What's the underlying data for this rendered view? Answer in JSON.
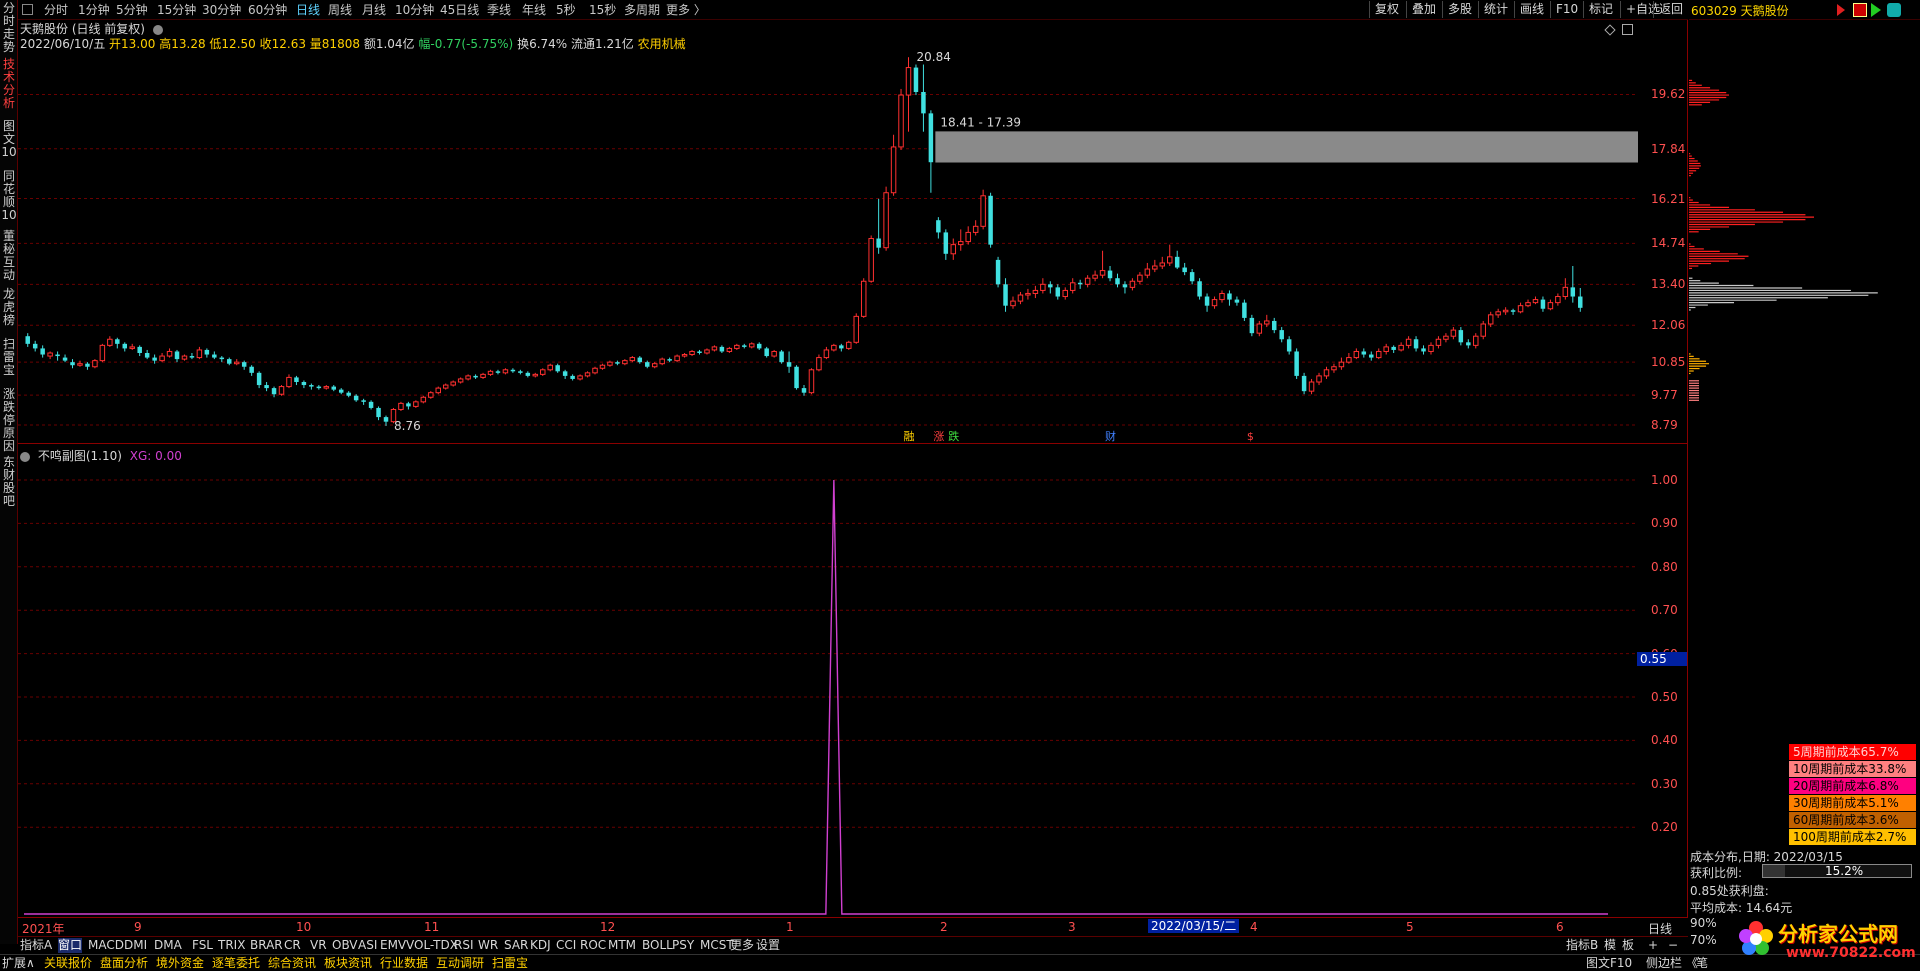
{
  "timeframes": [
    "分时",
    "1分钟",
    "5分钟",
    "15分钟",
    "30分钟",
    "60分钟",
    "日线",
    "周线",
    "月线",
    "10分钟",
    "45日线",
    "季线",
    "年线",
    "5秒",
    "15秒",
    "多周期",
    "更多 〉"
  ],
  "active_timeframe": "日线",
  "toolbar_right": [
    "复权",
    "叠加",
    "多股",
    "统计",
    "画线",
    "F10",
    "标记",
    "+自选",
    "返回"
  ],
  "stock_header": "603029 天鹅股份",
  "left_tabs": [
    "分时走势",
    "技术分析",
    "图文10",
    "同花顺10",
    "董秘互动",
    "龙虎榜",
    "扫雷宝",
    "涨跌停原因",
    "东财股吧"
  ],
  "active_left_tab": "技术分析",
  "title": "天鹅股份 (日线 前复权)",
  "info": {
    "date": "2022/06/10/五",
    "open": "开13.00",
    "high": "高13.28",
    "low": "低12.50",
    "close": "收12.63",
    "vol": "量81808",
    "amt": "额1.04亿",
    "chg": "幅-0.77(-5.75%)",
    "turnover": "换6.74%",
    "float": "流通1.21亿",
    "industry": "农用机械"
  },
  "annotations": {
    "high_label": "20.84",
    "low_label": "8.76",
    "gap_label": "18.41 - 17.39"
  },
  "markers": [
    "融",
    "涨",
    "跌",
    "财",
    "$"
  ],
  "price_axis": [
    "19.62",
    "17.84",
    "16.21",
    "14.74",
    "13.40",
    "12.06",
    "10.85",
    "9.77",
    "8.79"
  ],
  "sub_title": "不鸣副图(1.10)",
  "sub_xg": "XG: 0.00",
  "sub_axis": [
    "1.00",
    "0.90",
    "0.80",
    "0.70",
    "0.60",
    "0.50",
    "0.40",
    "0.30",
    "0.20"
  ],
  "sub_cursor": "0.55",
  "x_labels": [
    "2021年",
    "9",
    "10",
    "11",
    "12",
    "1",
    "2",
    "3",
    "4",
    "5",
    "6"
  ],
  "date_cursor": "2022/03/15/二",
  "x_axis_right": "日线",
  "indicator_tabs": [
    "指标A",
    "窗口",
    "MACD",
    "DMI",
    "DMA",
    "FSL",
    "TRIX",
    "BRAR",
    "CR",
    "VR",
    "OBV",
    "ASI",
    "EMV",
    "VOL-TDX",
    "RSI",
    "WR",
    "SAR",
    "KDJ",
    "CCI",
    "ROC",
    "MTM",
    "BOLL",
    "PSY",
    "MCST",
    "更多",
    "设置"
  ],
  "indicator_right": [
    "指标B",
    "模",
    "板",
    "+",
    "−"
  ],
  "bottom_tabs": [
    "扩展∧",
    "关联报价",
    "盘面分析",
    "境外资金",
    "逐笔委托",
    "综合资讯",
    "板块资讯",
    "行业数据",
    "互动调研",
    "扫雷宝"
  ],
  "bottom_right": [
    "图文F10",
    "侧边栏 《",
    "笔"
  ],
  "cost": {
    "rows": [
      {
        "label": "5周期前成本65.7%",
        "color": "#ff0000"
      },
      {
        "label": "10周期前成本33.8%",
        "color": "#ff8080"
      },
      {
        "label": "20周期前成本6.8%",
        "color": "#ff0080"
      },
      {
        "label": "30周期前成本5.1%",
        "color": "#ff8000"
      },
      {
        "label": "60周期前成本3.6%",
        "color": "#c06000"
      },
      {
        "label": "100周期前成本2.7%",
        "color": "#ffc000"
      }
    ],
    "date_line": "成本分布,日期: 2022/03/15",
    "profit_label": "获利比例:",
    "profit_value": "15.2%",
    "profit_at": "0.85处获利盘:",
    "avg_cost": "平均成本: 14.64元",
    "pct90": "90%",
    "pct70": "70%"
  },
  "watermark": {
    "text": "分析家公式网",
    "url": "www.70822.com"
  },
  "chart_data": {
    "type": "candlestick",
    "ylim": [
      8.3,
      21.6
    ],
    "candles": [
      [
        11.7,
        11.45,
        11.8,
        11.35
      ],
      [
        11.45,
        11.3,
        11.55,
        11.2
      ],
      [
        11.3,
        11.1,
        11.4,
        11.0
      ],
      [
        11.05,
        11.15,
        11.2,
        10.95
      ],
      [
        11.1,
        11.05,
        11.2,
        10.9
      ],
      [
        11.0,
        10.9,
        11.1,
        10.85
      ],
      [
        10.85,
        10.75,
        10.95,
        10.65
      ],
      [
        10.75,
        10.8,
        10.9,
        10.7
      ],
      [
        10.8,
        10.7,
        10.85,
        10.6
      ],
      [
        10.7,
        10.9,
        10.95,
        10.65
      ],
      [
        10.9,
        11.4,
        11.45,
        10.85
      ],
      [
        11.4,
        11.6,
        11.7,
        11.35
      ],
      [
        11.6,
        11.45,
        11.65,
        11.3
      ],
      [
        11.45,
        11.3,
        11.5,
        11.2
      ],
      [
        11.3,
        11.35,
        11.45,
        11.25
      ],
      [
        11.35,
        11.15,
        11.4,
        11.05
      ],
      [
        11.15,
        11.0,
        11.25,
        10.95
      ],
      [
        11.0,
        10.9,
        11.1,
        10.8
      ],
      [
        10.9,
        11.05,
        11.15,
        10.85
      ],
      [
        11.05,
        11.2,
        11.3,
        11.0
      ],
      [
        11.2,
        10.95,
        11.25,
        10.85
      ],
      [
        10.95,
        11.05,
        11.1,
        10.9
      ],
      [
        11.05,
        11.0,
        11.15,
        10.95
      ],
      [
        11.0,
        11.25,
        11.35,
        10.95
      ],
      [
        11.25,
        11.1,
        11.3,
        11.0
      ],
      [
        11.1,
        11.0,
        11.2,
        10.95
      ],
      [
        11.0,
        10.95,
        11.05,
        10.85
      ],
      [
        10.95,
        10.8,
        11.0,
        10.75
      ],
      [
        10.8,
        10.85,
        10.95,
        10.75
      ],
      [
        10.85,
        10.7,
        10.9,
        10.6
      ],
      [
        10.7,
        10.5,
        10.75,
        10.4
      ],
      [
        10.5,
        10.1,
        10.55,
        10.0
      ],
      [
        10.1,
        10.0,
        10.2,
        9.9
      ],
      [
        10.0,
        9.8,
        10.05,
        9.7
      ],
      [
        9.8,
        10.05,
        10.1,
        9.75
      ],
      [
        10.05,
        10.35,
        10.45,
        10.0
      ],
      [
        10.35,
        10.2,
        10.4,
        10.1
      ],
      [
        10.2,
        10.1,
        10.25,
        10.0
      ],
      [
        10.1,
        10.05,
        10.15,
        9.95
      ],
      [
        10.05,
        10.0,
        10.1,
        9.95
      ],
      [
        10.0,
        10.05,
        10.1,
        9.95
      ],
      [
        10.05,
        9.95,
        10.1,
        9.9
      ],
      [
        9.95,
        9.85,
        10.0,
        9.8
      ],
      [
        9.85,
        9.75,
        9.9,
        9.7
      ],
      [
        9.75,
        9.6,
        9.8,
        9.55
      ],
      [
        9.6,
        9.55,
        9.65,
        9.45
      ],
      [
        9.55,
        9.35,
        9.6,
        9.3
      ],
      [
        9.35,
        9.05,
        9.4,
        8.95
      ],
      [
        9.05,
        8.9,
        9.1,
        8.76
      ],
      [
        8.9,
        9.3,
        9.35,
        8.85
      ],
      [
        9.3,
        9.5,
        9.55,
        9.25
      ],
      [
        9.5,
        9.4,
        9.55,
        9.3
      ],
      [
        9.4,
        9.55,
        9.6,
        9.35
      ],
      [
        9.55,
        9.7,
        9.75,
        9.5
      ],
      [
        9.7,
        9.85,
        9.9,
        9.65
      ],
      [
        9.85,
        10.0,
        10.05,
        9.8
      ],
      [
        10.0,
        10.1,
        10.15,
        9.95
      ],
      [
        10.1,
        10.2,
        10.25,
        10.05
      ],
      [
        10.2,
        10.3,
        10.35,
        10.15
      ],
      [
        10.3,
        10.4,
        10.45,
        10.25
      ],
      [
        10.4,
        10.35,
        10.45,
        10.3
      ],
      [
        10.35,
        10.45,
        10.5,
        10.3
      ],
      [
        10.45,
        10.55,
        10.6,
        10.4
      ],
      [
        10.55,
        10.5,
        10.6,
        10.45
      ],
      [
        10.5,
        10.6,
        10.65,
        10.45
      ],
      [
        10.6,
        10.55,
        10.65,
        10.5
      ],
      [
        10.55,
        10.5,
        10.6,
        10.45
      ],
      [
        10.5,
        10.4,
        10.55,
        10.35
      ],
      [
        10.4,
        10.45,
        10.5,
        10.35
      ],
      [
        10.45,
        10.6,
        10.65,
        10.4
      ],
      [
        10.6,
        10.75,
        10.8,
        10.55
      ],
      [
        10.75,
        10.55,
        10.8,
        10.5
      ],
      [
        10.55,
        10.4,
        10.6,
        10.3
      ],
      [
        10.4,
        10.3,
        10.45,
        10.25
      ],
      [
        10.3,
        10.4,
        10.45,
        10.25
      ],
      [
        10.4,
        10.5,
        10.55,
        10.35
      ],
      [
        10.5,
        10.65,
        10.7,
        10.45
      ],
      [
        10.65,
        10.75,
        10.8,
        10.6
      ],
      [
        10.75,
        10.85,
        10.9,
        10.7
      ],
      [
        10.85,
        10.8,
        10.9,
        10.75
      ],
      [
        10.8,
        10.9,
        10.95,
        10.75
      ],
      [
        10.9,
        11.0,
        11.05,
        10.85
      ],
      [
        11.0,
        10.85,
        11.05,
        10.8
      ],
      [
        10.85,
        10.7,
        10.9,
        10.65
      ],
      [
        10.7,
        10.8,
        10.85,
        10.65
      ],
      [
        10.8,
        10.95,
        11.0,
        10.75
      ],
      [
        10.95,
        10.9,
        11.0,
        10.85
      ],
      [
        10.9,
        11.05,
        11.1,
        10.85
      ],
      [
        11.05,
        11.1,
        11.15,
        11.0
      ],
      [
        11.1,
        11.2,
        11.25,
        11.05
      ],
      [
        11.2,
        11.15,
        11.25,
        11.1
      ],
      [
        11.15,
        11.25,
        11.3,
        11.1
      ],
      [
        11.25,
        11.35,
        11.4,
        11.2
      ],
      [
        11.35,
        11.2,
        11.4,
        11.15
      ],
      [
        11.2,
        11.3,
        11.35,
        11.15
      ],
      [
        11.3,
        11.4,
        11.45,
        11.25
      ],
      [
        11.4,
        11.35,
        11.45,
        11.3
      ],
      [
        11.35,
        11.45,
        11.5,
        11.3
      ],
      [
        11.45,
        11.3,
        11.5,
        11.25
      ],
      [
        11.3,
        11.05,
        11.35,
        11.0
      ],
      [
        11.05,
        11.2,
        11.25,
        11.0
      ],
      [
        11.2,
        10.85,
        11.25,
        10.8
      ],
      [
        10.85,
        10.7,
        11.2,
        10.5
      ],
      [
        10.7,
        10.0,
        10.75,
        9.95
      ],
      [
        10.0,
        9.85,
        10.1,
        9.75
      ],
      [
        9.85,
        10.6,
        10.65,
        9.8
      ],
      [
        10.6,
        11.0,
        11.1,
        10.55
      ],
      [
        11.0,
        11.25,
        11.35,
        10.95
      ],
      [
        11.25,
        11.4,
        11.45,
        11.2
      ],
      [
        11.4,
        11.3,
        11.45,
        11.2
      ],
      [
        11.3,
        11.5,
        11.55,
        11.25
      ],
      [
        11.5,
        12.35,
        12.45,
        11.45
      ],
      [
        12.35,
        13.5,
        13.6,
        12.3
      ],
      [
        13.5,
        14.9,
        15.0,
        13.45
      ],
      [
        14.9,
        14.6,
        16.2,
        14.4
      ],
      [
        14.6,
        16.4,
        16.6,
        14.5
      ],
      [
        16.4,
        17.9,
        18.3,
        16.3
      ],
      [
        17.9,
        19.6,
        19.8,
        17.8
      ],
      [
        19.6,
        20.5,
        20.84,
        18.4
      ],
      [
        20.5,
        19.7,
        20.6,
        19.6
      ],
      [
        19.7,
        19.0,
        20.6,
        18.4
      ],
      [
        19.0,
        17.4,
        19.1,
        16.4
      ],
      [
        15.5,
        15.1,
        15.6,
        14.9
      ],
      [
        15.1,
        14.4,
        15.2,
        14.2
      ],
      [
        14.4,
        14.7,
        14.9,
        14.2
      ],
      [
        14.7,
        14.8,
        15.2,
        14.5
      ],
      [
        14.8,
        15.1,
        15.3,
        14.7
      ],
      [
        15.1,
        15.3,
        15.5,
        15.0
      ],
      [
        15.3,
        16.3,
        16.5,
        15.2
      ],
      [
        16.3,
        14.7,
        16.4,
        14.6
      ],
      [
        14.2,
        13.4,
        14.3,
        13.3
      ],
      [
        13.4,
        12.7,
        13.6,
        12.5
      ],
      [
        12.7,
        12.85,
        13.0,
        12.6
      ],
      [
        12.85,
        13.05,
        13.15,
        12.75
      ],
      [
        13.05,
        13.1,
        13.25,
        12.9
      ],
      [
        13.1,
        13.2,
        13.35,
        12.95
      ],
      [
        13.2,
        13.4,
        13.6,
        13.1
      ],
      [
        13.4,
        13.3,
        13.5,
        13.1
      ],
      [
        13.3,
        13.0,
        13.4,
        12.9
      ],
      [
        13.0,
        13.2,
        13.3,
        12.9
      ],
      [
        13.2,
        13.45,
        13.6,
        13.1
      ],
      [
        13.45,
        13.4,
        13.55,
        13.25
      ],
      [
        13.4,
        13.6,
        13.7,
        13.3
      ],
      [
        13.6,
        13.7,
        13.85,
        13.5
      ],
      [
        13.7,
        13.85,
        14.5,
        13.6
      ],
      [
        13.85,
        13.6,
        14.0,
        13.5
      ],
      [
        13.6,
        13.4,
        13.75,
        13.3
      ],
      [
        13.4,
        13.3,
        13.5,
        13.1
      ],
      [
        13.3,
        13.5,
        13.6,
        13.2
      ],
      [
        13.5,
        13.7,
        13.8,
        13.4
      ],
      [
        13.7,
        13.9,
        14.1,
        13.6
      ],
      [
        13.9,
        14.0,
        14.2,
        13.8
      ],
      [
        14.0,
        14.1,
        14.3,
        13.9
      ],
      [
        14.1,
        14.3,
        14.7,
        14.0
      ],
      [
        14.3,
        13.95,
        14.5,
        13.9
      ],
      [
        13.95,
        13.8,
        14.1,
        13.7
      ],
      [
        13.8,
        13.5,
        13.9,
        13.4
      ],
      [
        13.5,
        13.0,
        13.6,
        12.9
      ],
      [
        13.0,
        12.7,
        13.1,
        12.5
      ],
      [
        12.7,
        12.9,
        13.0,
        12.6
      ],
      [
        12.9,
        13.1,
        13.2,
        12.8
      ],
      [
        13.1,
        12.9,
        13.2,
        12.7
      ],
      [
        12.9,
        12.8,
        13.0,
        12.7
      ],
      [
        12.8,
        12.3,
        12.9,
        12.2
      ],
      [
        12.3,
        11.8,
        12.4,
        11.7
      ],
      [
        11.8,
        12.1,
        12.2,
        11.7
      ],
      [
        12.1,
        12.2,
        12.4,
        12.0
      ],
      [
        12.2,
        11.9,
        12.3,
        11.8
      ],
      [
        11.9,
        11.6,
        12.0,
        11.5
      ],
      [
        11.6,
        11.2,
        11.7,
        11.1
      ],
      [
        11.2,
        10.4,
        11.3,
        10.3
      ],
      [
        10.4,
        9.9,
        10.5,
        9.8
      ],
      [
        9.9,
        10.2,
        10.3,
        9.8
      ],
      [
        10.2,
        10.4,
        10.5,
        10.1
      ],
      [
        10.4,
        10.6,
        10.7,
        10.3
      ],
      [
        10.6,
        10.7,
        10.8,
        10.5
      ],
      [
        10.7,
        10.85,
        11.0,
        10.6
      ],
      [
        10.85,
        11.0,
        11.15,
        10.8
      ],
      [
        11.0,
        11.2,
        11.3,
        10.95
      ],
      [
        11.2,
        11.1,
        11.3,
        11.0
      ],
      [
        11.1,
        11.0,
        11.2,
        10.9
      ],
      [
        11.0,
        11.2,
        11.3,
        10.95
      ],
      [
        11.2,
        11.35,
        11.45,
        11.1
      ],
      [
        11.35,
        11.25,
        11.4,
        11.15
      ],
      [
        11.25,
        11.4,
        11.5,
        11.2
      ],
      [
        11.4,
        11.6,
        11.7,
        11.3
      ],
      [
        11.6,
        11.3,
        11.7,
        11.2
      ],
      [
        11.3,
        11.2,
        11.4,
        11.1
      ],
      [
        11.2,
        11.4,
        11.5,
        11.1
      ],
      [
        11.4,
        11.6,
        11.7,
        11.3
      ],
      [
        11.6,
        11.7,
        11.8,
        11.5
      ],
      [
        11.7,
        11.9,
        12.0,
        11.6
      ],
      [
        11.9,
        11.5,
        12.0,
        11.4
      ],
      [
        11.5,
        11.4,
        11.6,
        11.3
      ],
      [
        11.4,
        11.7,
        11.8,
        11.3
      ],
      [
        11.7,
        12.1,
        12.2,
        11.6
      ],
      [
        12.1,
        12.4,
        12.5,
        12.0
      ],
      [
        12.4,
        12.5,
        12.6,
        12.3
      ],
      [
        12.5,
        12.55,
        12.65,
        12.4
      ],
      [
        12.55,
        12.5,
        12.6,
        12.4
      ],
      [
        12.5,
        12.7,
        12.8,
        12.45
      ],
      [
        12.7,
        12.8,
        12.9,
        12.65
      ],
      [
        12.8,
        12.9,
        13.0,
        12.75
      ],
      [
        12.9,
        12.6,
        13.0,
        12.5
      ],
      [
        12.6,
        12.8,
        12.9,
        12.55
      ],
      [
        12.8,
        13.0,
        13.1,
        12.7
      ],
      [
        13.0,
        13.3,
        13.6,
        12.9
      ],
      [
        13.3,
        13.0,
        14.0,
        12.8
      ],
      [
        13.0,
        12.63,
        13.28,
        12.5
      ]
    ],
    "sub_series": {
      "name": "XG",
      "spike_index": 108,
      "spike_value": 1.0
    }
  }
}
